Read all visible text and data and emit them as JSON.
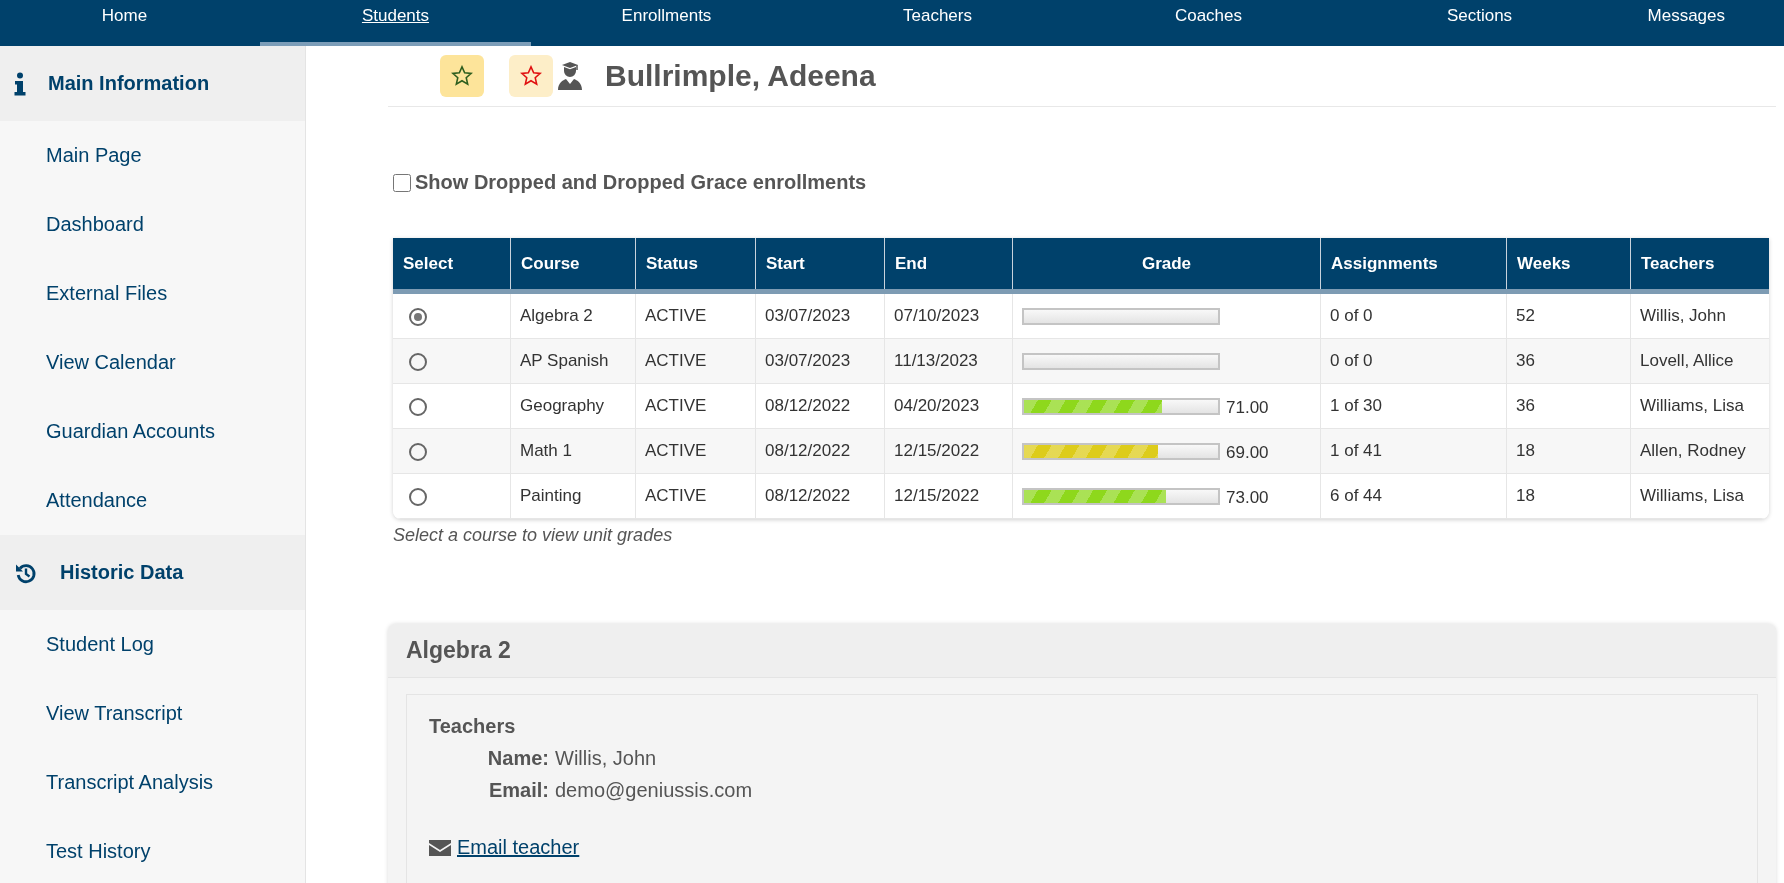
{
  "nav": [
    {
      "label": "Home",
      "selected": false
    },
    {
      "label": "Students",
      "selected": true
    },
    {
      "label": "Enrollments",
      "selected": false
    },
    {
      "label": "Teachers",
      "selected": false
    },
    {
      "label": "Coaches",
      "selected": false
    },
    {
      "label": "Sections",
      "selected": false
    },
    {
      "label": "Messages",
      "selected": false
    }
  ],
  "sidebar": {
    "sections": [
      {
        "kind": "info",
        "title": "Main Information",
        "items": [
          "Main Page",
          "Dashboard",
          "External Files",
          "View Calendar",
          "Guardian Accounts",
          "Attendance"
        ]
      },
      {
        "kind": "history",
        "title": "Historic Data",
        "items": [
          "Student Log",
          "View Transcript",
          "Transcript Analysis",
          "Test History"
        ]
      }
    ]
  },
  "student_name": "Bullrimple, Adeena",
  "show_dropped": {
    "label": "Show Dropped and Dropped Grace enrollments",
    "checked": false
  },
  "table": {
    "columns": [
      "Select",
      "Course",
      "Status",
      "Start",
      "End",
      "Grade",
      "Assignments",
      "Weeks",
      "Teachers"
    ],
    "rows": [
      {
        "selected": true,
        "course": "Algebra 2",
        "status": "ACTIVE",
        "start": "03/07/2023",
        "end": "07/10/2023",
        "assignments": "0 of 0",
        "weeks": "52",
        "teacher": "Willis, John"
      },
      {
        "selected": false,
        "course": "AP Spanish",
        "status": "ACTIVE",
        "start": "03/07/2023",
        "end": "11/13/2023",
        "assignments": "0 of 0",
        "weeks": "36",
        "teacher": "Lovell, Allice"
      },
      {
        "selected": false,
        "course": "Geography",
        "status": "ACTIVE",
        "start": "08/12/2022",
        "end": "04/20/2023",
        "grade": {
          "level": 0.71,
          "color": "#8ed81c",
          "reading": "71.00"
        },
        "assignments": "1 of 30",
        "weeks": "36",
        "teacher": "Williams, Lisa"
      },
      {
        "selected": false,
        "course": "Math 1",
        "status": "ACTIVE",
        "start": "08/12/2022",
        "end": "12/15/2022",
        "grade": {
          "level": 0.69,
          "color": "#ddcc1a",
          "reading": "69.00"
        },
        "assignments": "1 of 41",
        "weeks": "18",
        "teacher": "Allen, Rodney"
      },
      {
        "selected": false,
        "course": "Painting",
        "status": "ACTIVE",
        "start": "08/12/2022",
        "end": "12/15/2022",
        "grade": {
          "level": 0.73,
          "color": "#8ed81c",
          "reading": "73.00"
        },
        "assignments": "6 of 44",
        "weeks": "18",
        "teacher": "Williams, Lisa"
      }
    ]
  },
  "caption": "Select a course to view unit grades",
  "course_panel": {
    "title": "Algebra 2",
    "section_title": "Teachers",
    "fields": [
      {
        "label": "Name:",
        "value": "Willis, John"
      },
      {
        "label": "Email:",
        "value": "demo@geniussis.com"
      }
    ],
    "link": "Email teacher"
  }
}
